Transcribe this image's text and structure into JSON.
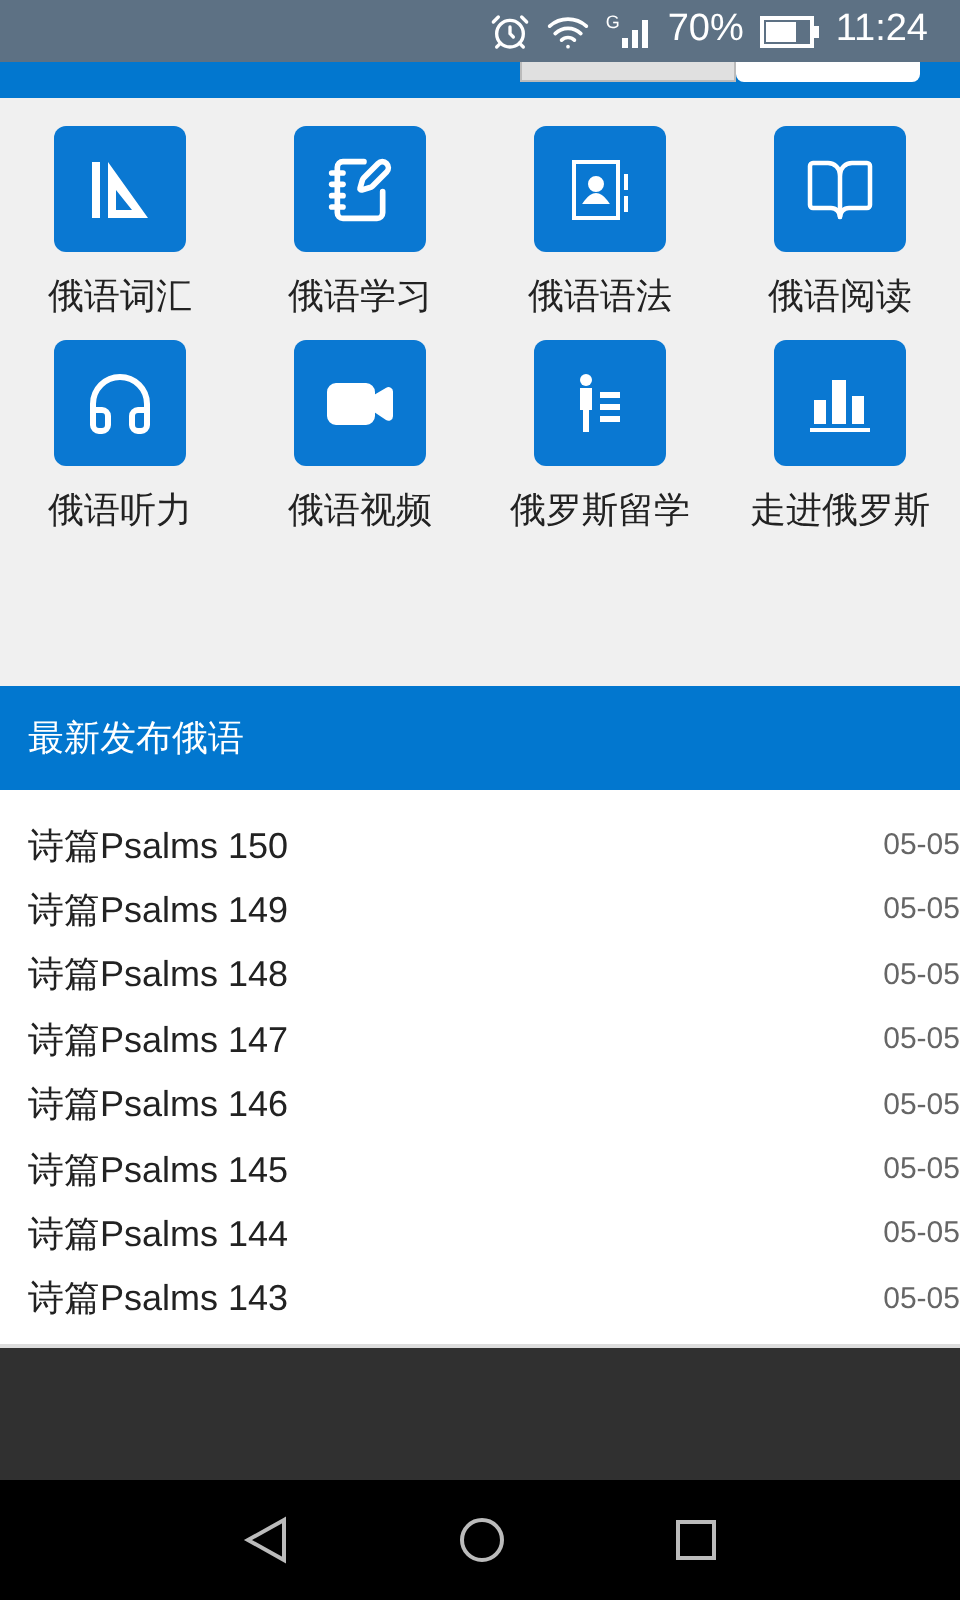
{
  "status_bar": {
    "network": "G",
    "battery": "70%",
    "time": "11:24"
  },
  "categories": [
    {
      "label": "俄语词汇"
    },
    {
      "label": "俄语学习"
    },
    {
      "label": "俄语语法"
    },
    {
      "label": "俄语阅读"
    },
    {
      "label": "俄语听力"
    },
    {
      "label": "俄语视频"
    },
    {
      "label": "俄罗斯留学"
    },
    {
      "label": "走进俄罗斯"
    }
  ],
  "latest": {
    "title": "最新发布俄语",
    "items": [
      {
        "title": "诗篇Psalms 150",
        "date": "05-05"
      },
      {
        "title": "诗篇Psalms 149",
        "date": "05-05"
      },
      {
        "title": "诗篇Psalms 148",
        "date": "05-05"
      },
      {
        "title": "诗篇Psalms 147",
        "date": "05-05"
      },
      {
        "title": "诗篇Psalms 146",
        "date": "05-05"
      },
      {
        "title": "诗篇Psalms 145",
        "date": "05-05"
      },
      {
        "title": "诗篇Psalms 144",
        "date": "05-05"
      },
      {
        "title": "诗篇Psalms 143",
        "date": "05-05"
      }
    ]
  }
}
